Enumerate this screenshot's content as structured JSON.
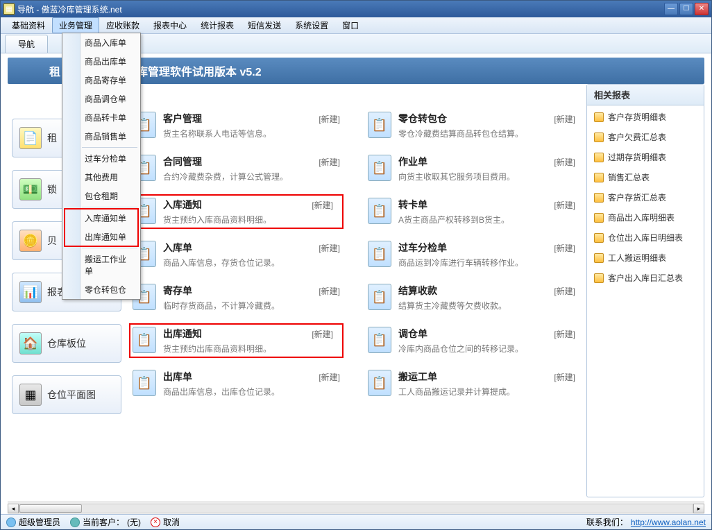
{
  "title": "导航 - 傲蓝冷库管理系统.net",
  "menubar": [
    "基础资料",
    "业务管理",
    "应收账款",
    "报表中心",
    "统计报表",
    "短信发送",
    "系统设置",
    "窗口"
  ],
  "tab": "导航",
  "banner_prefix": "租",
  "banner_suffix": "库管理软件试用版本 v5.2",
  "dropdown": {
    "group1": [
      "商品入库单",
      "商品出库单",
      "商品寄存单",
      "商品调仓单",
      "商品转卡单",
      "商品销售单"
    ],
    "group2": [
      "过车分检单",
      "其他费用",
      "包仓租期"
    ],
    "group3": [
      "入库通知单",
      "出库通知单"
    ],
    "group4": [
      "搬运工作业单",
      "零仓转包仓"
    ]
  },
  "sidebar": [
    {
      "label": "租",
      "icon": "icon-yellow"
    },
    {
      "label": "锁",
      "icon": "icon-green"
    },
    {
      "label": "贝",
      "icon": "icon-orange"
    },
    {
      "label": "报表中心",
      "icon": "icon-blue"
    },
    {
      "label": "仓库板位",
      "icon": "icon-teal"
    },
    {
      "label": "仓位平面图",
      "icon": "icon-grey"
    }
  ],
  "modules": [
    {
      "title": "客户管理",
      "desc": "货主名称联系人电话等信息。",
      "new": "[新建]"
    },
    {
      "title": "零仓转包仓",
      "desc": "零仓冷藏费结算商品转包仓结算。",
      "new": "[新建]"
    },
    {
      "title": "合同管理",
      "desc": "合约冷藏费杂费，计算公式管理。",
      "new": "[新建]"
    },
    {
      "title": "作业单",
      "desc": "向货主收取其它服务项目费用。",
      "new": "[新建]"
    },
    {
      "title": "入库通知",
      "desc": "货主预约入库商品资料明细。",
      "new": "[新建]",
      "hl": true
    },
    {
      "title": "转卡单",
      "desc": "A货主商品产权转移到B货主。",
      "new": "[新建]"
    },
    {
      "title": "入库单",
      "desc": "商品入库信息，存货仓位记录。",
      "new": "[新建]"
    },
    {
      "title": "过车分检单",
      "desc": "商品运到冷库进行车辆转移作业。",
      "new": "[新建]"
    },
    {
      "title": "寄存单",
      "desc": "临时存货商品，不计算冷藏费。",
      "new": "[新建]"
    },
    {
      "title": "结算收款",
      "desc": "结算货主冷藏费等欠费收款。",
      "new": "[新建]"
    },
    {
      "title": "出库通知",
      "desc": "货主预约出库商品资料明细。",
      "new": "[新建]",
      "hl": true
    },
    {
      "title": "调仓单",
      "desc": "冷库内商品仓位之间的转移记录。",
      "new": "[新建]"
    },
    {
      "title": "出库单",
      "desc": "商品出库信息，出库仓位记录。",
      "new": "[新建]"
    },
    {
      "title": "搬运工单",
      "desc": "工人商品搬运记录并计算提成。",
      "new": "[新建]"
    }
  ],
  "reports_header": "相关报表",
  "reports": [
    "客户存货明细表",
    "客户欠费汇总表",
    "过期存货明细表",
    "销售汇总表",
    "客户存货汇总表",
    "商品出入库明细表",
    "仓位出入库日明细表",
    "工人搬运明细表",
    "客户出入库日汇总表"
  ],
  "status": {
    "user": "超级管理员",
    "cust_label": "当前客户：",
    "cust_value": "(无)",
    "cancel": "取消",
    "contact_label": "联系我们：",
    "contact_url": "http://www.aolan.net"
  }
}
